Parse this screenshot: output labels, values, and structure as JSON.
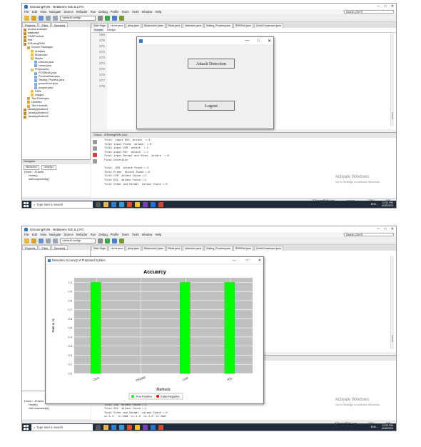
{
  "ide": {
    "window_title": "IDSusingRNN - NetBeans IDE 8.2 RC",
    "window_buttons": [
      "—",
      "□",
      "✕"
    ],
    "menu": [
      "File",
      "Edit",
      "View",
      "Navigate",
      "Source",
      "Refactor",
      "Run",
      "Debug",
      "Profile",
      "Team",
      "Tools",
      "Window",
      "Help"
    ],
    "search_placeholder": "Search (Ctrl+I)",
    "config": "<default config>",
    "projects_tabs": [
      "Projects",
      "Files",
      "Services"
    ],
    "tree": [
      {
        "label": "access.example",
        "indent": 0,
        "color": "#c78a2c"
      },
      {
        "label": "database",
        "indent": 0,
        "color": "#c78a2c"
      },
      {
        "label": "DSAPractical",
        "indent": 0,
        "color": "#c78a2c"
      },
      {
        "label": "first",
        "indent": 0,
        "color": "#c78a2c"
      },
      {
        "label": "IDSusingRNN",
        "indent": 0,
        "color": "#c78a2c"
      },
      {
        "label": "Source Packages",
        "indent": 1,
        "color": "#d9a441"
      },
      {
        "label": "Analysis",
        "indent": 2,
        "color": "#e6c15a"
      },
      {
        "label": "Blockchan",
        "indent": 2,
        "color": "#e6c15a"
      },
      {
        "label": "Master",
        "indent": 2,
        "color": "#e6c15a"
      },
      {
        "label": "Dbconn.java",
        "indent": 3,
        "color": "#7fa7d9"
      },
      {
        "label": "Home.java",
        "indent": 3,
        "color": "#7fa7d9"
      },
      {
        "label": "Preprocess",
        "indent": 2,
        "color": "#e6c15a"
      },
      {
        "label": "POSBlock.java",
        "indent": 3,
        "color": "#7fa7d9"
      },
      {
        "label": "ProcessData.java",
        "indent": 3,
        "color": "#7fa7d9"
      },
      {
        "label": "Testing_Process.java",
        "indent": 3,
        "color": "#7fa7d9"
      },
      {
        "label": "posmethod.java",
        "indent": 3,
        "color": "#7fa7d9"
      },
      {
        "label": "posphp.java",
        "indent": 3,
        "color": "#7fa7d9"
      },
      {
        "label": "RNN",
        "indent": 2,
        "color": "#e6c15a"
      },
      {
        "label": "images",
        "indent": 2,
        "color": "#e6c15a"
      },
      {
        "label": "Test Packages",
        "indent": 1,
        "color": "#d9a441"
      },
      {
        "label": "Libraries",
        "indent": 1,
        "color": "#d9a441"
      },
      {
        "label": "Test Libraries",
        "indent": 1,
        "color": "#d9a441"
      },
      {
        "label": "JavaApplication1",
        "indent": 0,
        "color": "#c78a2c"
      },
      {
        "label": "JavaApplication4",
        "indent": 0,
        "color": "#c78a2c"
      },
      {
        "label": "JavaApplication5",
        "indent": 0,
        "color": "#c78a2c"
      }
    ],
    "navigator": {
      "title": "Navigator",
      "members": "Members",
      "empty": "<empty>",
      "items": [
        "Home :: JFrame",
        "Home()",
        "initComponents()"
      ]
    },
    "editor_tabs": [
      "Start Page",
      "Home.java",
      "pbsp.java",
      "Blockchain1.java",
      "Block.java",
      "Detection.java",
      "Testing_Process.java",
      "RNNTest.java",
      "ChainConsensus.java"
    ],
    "sub_tabs": [
      "Source",
      "Design"
    ],
    "line_numbers": [
      "169",
      "170",
      "171",
      "172",
      "173",
      "174",
      "175",
      "176",
      "177",
      "178"
    ],
    "output_title": "Output - IDSusingRNN (run)",
    "output_lines_1": [
      "Total  input DOS  attack  =-3",
      "Total input Probe  attack  =-0",
      "Total input U2R  attack  =-1",
      "Total input R2L  attack  =-1",
      "Total input Normal and Other  attack  =-0",
      "Final Detection",
      "",
      "Total  DOS  attack found =-3",
      "Total Probe  attack found =-0",
      "Total U2R  attack found =-1",
      "Total R2L  attack found =-1",
      "Total Other and Normal  attack found =-0"
    ],
    "output_lines_2": [
      "Total Probe  attack found =-0",
      "Total U2R  attack found =-1",
      "Total R2L  attack found =-1",
      "Total Other and Normal  attack found =-0",
      "a=-1.0   b=-NaN  c=-1.0  d=-1.0  e=-NaN"
    ],
    "watermark_title": "Activate Windows",
    "watermark_sub": "Go to Settings to activate Windows.",
    "status_project": "IDSusingRNN (run)",
    "status_running": "running...",
    "status_pos": "178:1",
    "status_ins": "INS"
  },
  "taskbar": {
    "search": "Type here to search",
    "ticker": "BSE...",
    "time_1": "12:02 PM",
    "date_1": "4/18/2024",
    "time_2": "12:03 PM",
    "date_2": "4/18/2024"
  },
  "dialog1": {
    "attack_detection": "Attack Detection",
    "logout": "Logout"
  },
  "graph_window": {
    "title": "Detection Accuracy of Proposed System"
  },
  "chart_data": {
    "type": "bar",
    "title": "Accuarcy",
    "xlabel": "Methods",
    "ylabel": "Rate in %",
    "categories": [
      "DOS",
      "PROBE",
      "U2R",
      "R2L"
    ],
    "series": [
      {
        "name": "True Positive",
        "values": [
          1.0,
          0,
          1.0,
          1.0
        ]
      },
      {
        "name": "False Negative",
        "values": [
          0,
          0,
          0,
          0
        ]
      }
    ],
    "ylim": [
      0,
      1.05
    ],
    "yticks": [
      "0.0",
      "0.1",
      "0.2",
      "0.3",
      "0.4",
      "0.5",
      "0.6",
      "0.7",
      "0.8",
      "0.9",
      "1.0"
    ],
    "grid": true,
    "legend": "bottom",
    "colors": {
      "true_positive": "#00ff00",
      "false_negative": "#ff0000",
      "plot_bg": "#c0c0c0"
    }
  }
}
